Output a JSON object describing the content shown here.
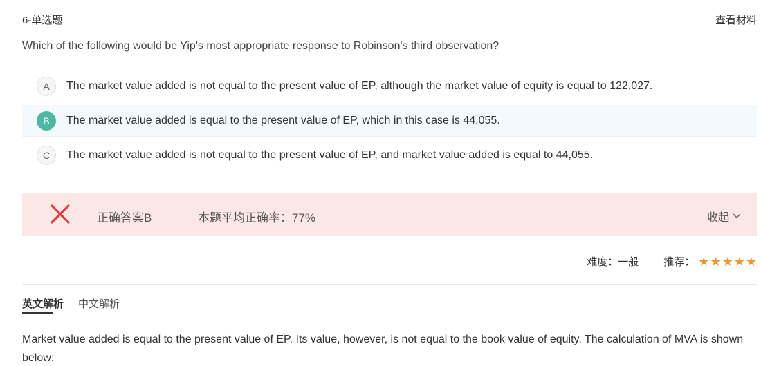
{
  "header": {
    "title": "6-单选题",
    "material_link": "查看材料"
  },
  "question": "Which of the following would be Yip's most appropriate response to Robinson's third observation?",
  "options": [
    {
      "letter": "A",
      "text": "The market value added is not equal to the present value of EP, although the market value of equity is equal to 122,027."
    },
    {
      "letter": "B",
      "text": "The market value added is equal to the present value of EP, which in this case is 44,055."
    },
    {
      "letter": "C",
      "text": "The market value added is not equal to the present value of EP, and market value added is equal to 44,055."
    }
  ],
  "selected_option": "B",
  "result": {
    "correct_answer": "正确答案B",
    "avg_rate": "本题平均正确率：77%",
    "collapse": "收起",
    "status_color": "#e53935"
  },
  "meta": {
    "difficulty": "难度：一般",
    "recommend_label": "推荐：",
    "stars": 5,
    "star_color": "#f0962f"
  },
  "tabs": {
    "english": "英文解析",
    "chinese": "中文解析"
  },
  "explanation": "Market value added is equal to the present value of EP. Its value, however, is not equal to the book value of equity. The calculation of MVA is shown below:"
}
